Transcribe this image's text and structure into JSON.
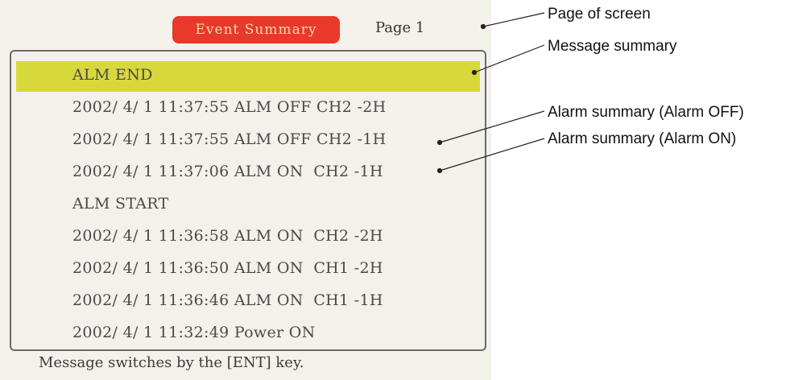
{
  "screen": {
    "title": "Event Summary",
    "page_label": "Page 1"
  },
  "rows": [
    "ALM END",
    "2002/ 4/ 1 11:37:55 ALM OFF CH2 -2H",
    "2002/ 4/ 1 11:37:55 ALM OFF CH2 -1H",
    "2002/ 4/ 1 11:37:06 ALM ON  CH2 -1H",
    "ALM START",
    "2002/ 4/ 1 11:36:58 ALM ON  CH2 -2H",
    "2002/ 4/ 1 11:36:50 ALM ON  CH1 -2H",
    "2002/ 4/ 1 11:36:46 ALM ON  CH1 -1H",
    "2002/ 4/ 1 11:32:49 Power ON"
  ],
  "footer": "Message switches by the [ENT] key.",
  "annotations": {
    "page_of_screen": "Page of screen",
    "message_summary": "Message summary",
    "alarm_off": "Alarm summary (Alarm OFF)",
    "alarm_on": "Alarm summary (Alarm ON)"
  },
  "colors": {
    "title_badge": "#e8392a",
    "highlight_row": "#d9d83a"
  }
}
